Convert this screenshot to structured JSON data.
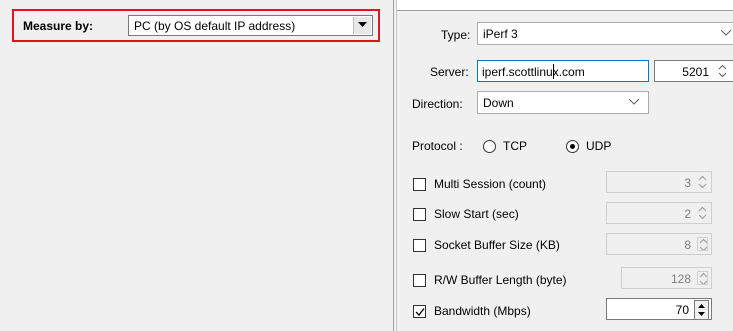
{
  "measure": {
    "label": "Measure by:",
    "selected": "PC (by OS default IP address)"
  },
  "settings": {
    "type_label": "Type:",
    "type_value": "iPerf 3",
    "server_label": "Server:",
    "server_value": "iperf.scottlinux.com",
    "port_value": "5201",
    "direction_label": "Direction:",
    "direction_value": "Down",
    "protocol_label": "Protocol :",
    "protocol_tcp": "TCP",
    "protocol_udp": "UDP",
    "protocol_selected": "UDP"
  },
  "options": [
    {
      "label": "Multi Session (count)",
      "value": "3",
      "checked": false
    },
    {
      "label": "Slow Start (sec)",
      "value": "2",
      "checked": false
    },
    {
      "label": "Socket Buffer Size (KB)",
      "value": "8",
      "checked": false
    },
    {
      "label": "R/W Buffer Length (byte)",
      "value": "128",
      "checked": false
    },
    {
      "label": "Bandwidth (Mbps)",
      "value": "70",
      "checked": true
    }
  ],
  "colors": {
    "highlight": "#e0141e",
    "focus_border": "#0078d7",
    "panel_bg": "#f0f0f0"
  }
}
